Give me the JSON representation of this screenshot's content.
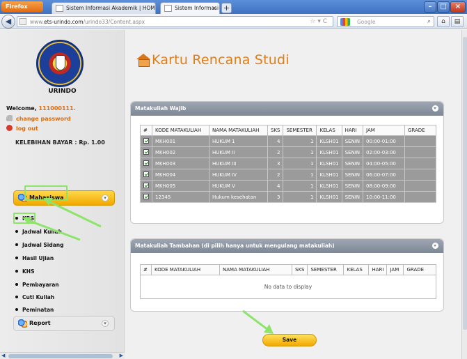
{
  "browser": {
    "app_button": "Firefox",
    "tabs": [
      {
        "label": "Sistem Informasi Akademik | HOME"
      },
      {
        "label": "Sistem Informasi Akademik | HOME",
        "close": "×"
      }
    ],
    "new_tab": "+",
    "url_prefix": "www.",
    "url_domain": "ets-urindo.com",
    "url_path": "/urindo33/Content.aspx",
    "search_placeholder": "Google"
  },
  "sidebar": {
    "logo_caption": "URINDO",
    "welcome_label": "Welcome,",
    "user_id": "111000111.",
    "change_password": "change password",
    "logout": "log out",
    "kelebihan": "KELEBIHAN BAYAR : Rp. 1.00",
    "mahasiswa_label": "Mahasiswa",
    "menu_items": [
      "KRS",
      "Jadwal Kuliah",
      "Jadwal Sidang",
      "Hasil Ujian",
      "KHS",
      "Pembayaran",
      "Cuti Kuliah",
      "Peminatan"
    ],
    "report_label": "Report"
  },
  "main": {
    "title": "Kartu Rencana Studi",
    "wajib": {
      "header": "Matakuliah Wajib",
      "columns": [
        "#",
        "KODE MATAKULIAH",
        "NAMA MATAKULIAH",
        "SKS",
        "SEMESTER",
        "KELAS",
        "HARI",
        "JAM",
        "GRADE"
      ],
      "rows": [
        {
          "kode": "MKH001",
          "nama": "HUKUM 1",
          "sks": "4",
          "semester": "1",
          "kelas": "KLSH01",
          "hari": "SENIN",
          "jam": "00:00-01:00",
          "grade": ""
        },
        {
          "kode": "MKH002",
          "nama": "HUKUM II",
          "sks": "2",
          "semester": "1",
          "kelas": "KLSH01",
          "hari": "SENIN",
          "jam": "02:00-03:00",
          "grade": ""
        },
        {
          "kode": "MKH003",
          "nama": "HUKUM III",
          "sks": "3",
          "semester": "1",
          "kelas": "KLSH01",
          "hari": "SENIN",
          "jam": "04:00-05:00",
          "grade": ""
        },
        {
          "kode": "MKH004",
          "nama": "HUKUM IV",
          "sks": "2",
          "semester": "1",
          "kelas": "KLSH01",
          "hari": "SENIN",
          "jam": "06:00-07:00",
          "grade": ""
        },
        {
          "kode": "MKH005",
          "nama": "HUKUM V",
          "sks": "4",
          "semester": "1",
          "kelas": "KLSH01",
          "hari": "SENIN",
          "jam": "08:00-09:00",
          "grade": ""
        },
        {
          "kode": "12345",
          "nama": "Hukum kesehatan",
          "sks": "3",
          "semester": "1",
          "kelas": "KLSH01",
          "hari": "SENIN",
          "jam": "10:00-11:00",
          "grade": ""
        }
      ]
    },
    "tambahan": {
      "header": "Matakuliah Tambahan (di pilih hanya untuk mengulang matakuliah)",
      "columns": [
        "#",
        "KODE MATAKULIAH",
        "NAMA MATAKULIAH",
        "SKS",
        "SEMESTER",
        "KELAS",
        "HARI",
        "JAM",
        "GRADE"
      ],
      "empty_text": "No data to display"
    },
    "save_label": "Save"
  },
  "colors": {
    "accent_orange": "#e07e16",
    "button_yellow": "#f2a800",
    "annotation_green": "#8ee36a",
    "panel_header": "#7d8795",
    "row_gray": "#9b9b9b"
  }
}
